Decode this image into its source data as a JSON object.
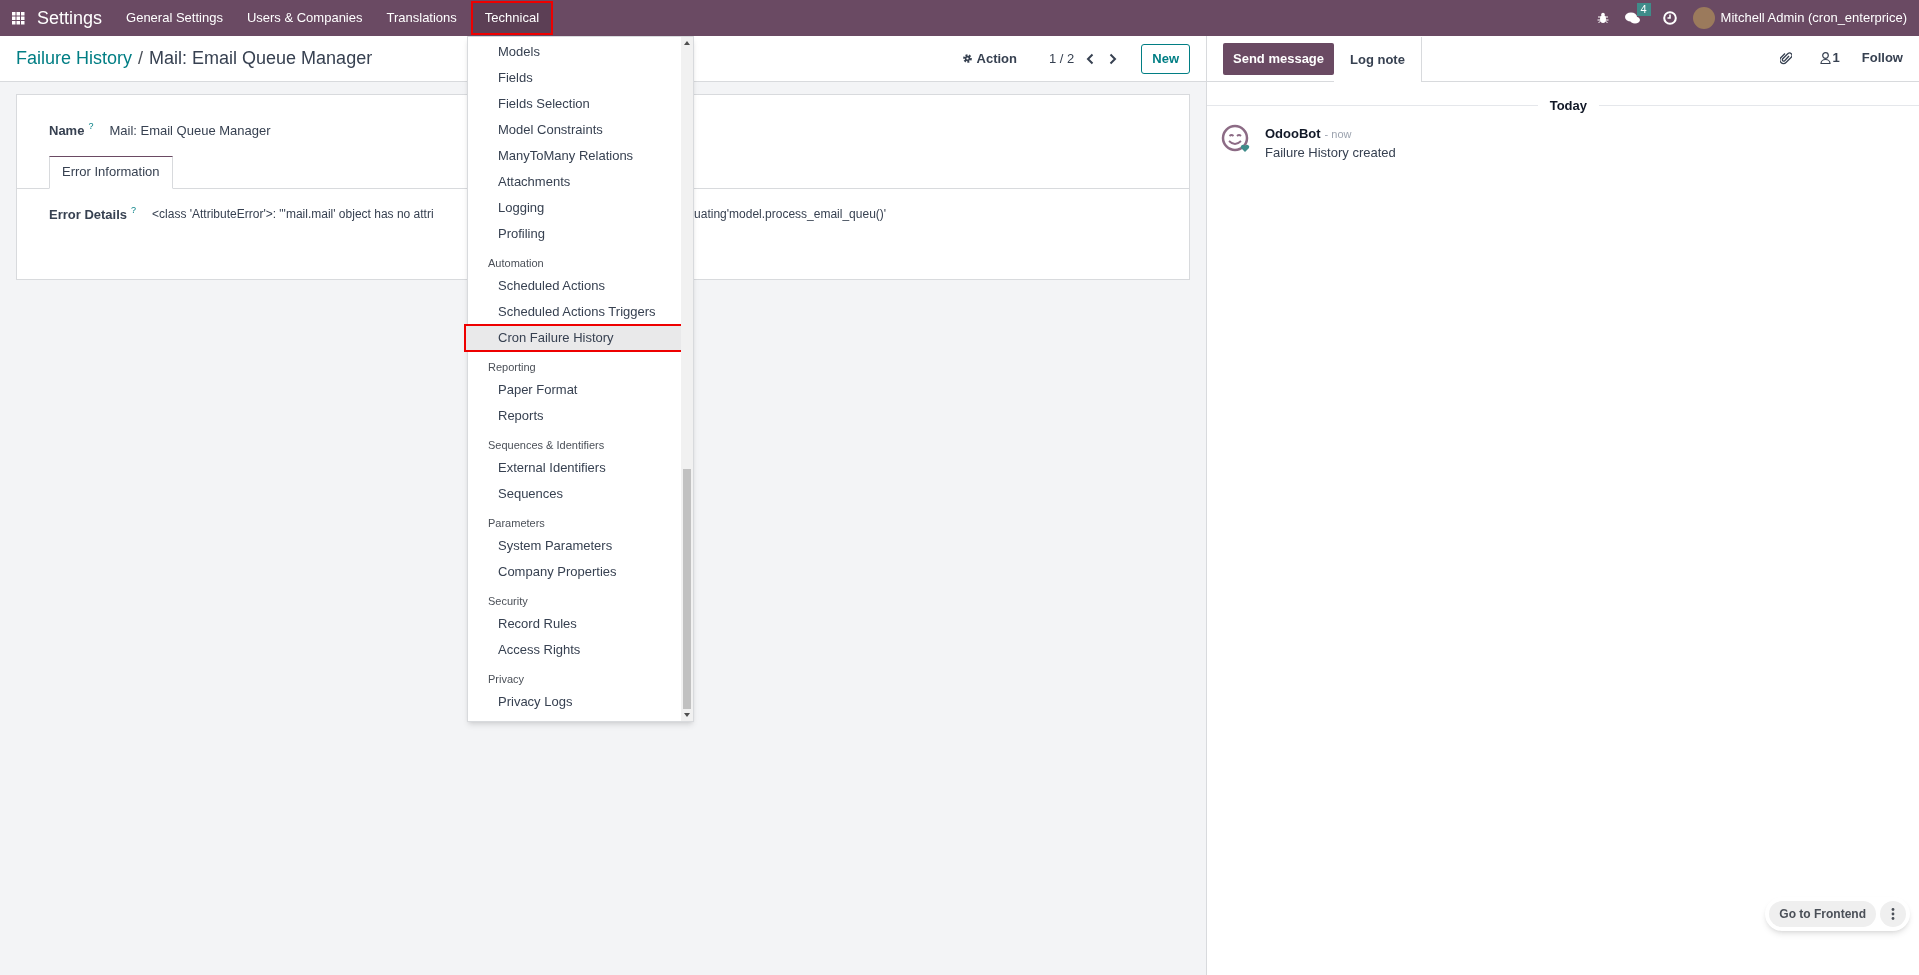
{
  "navbar": {
    "app_name": "Settings",
    "menus": [
      {
        "label": "General Settings",
        "selected": false
      },
      {
        "label": "Users & Companies",
        "selected": false
      },
      {
        "label": "Translations",
        "selected": false
      },
      {
        "label": "Technical",
        "selected": true
      }
    ],
    "messages_count": "4",
    "user_name": "Mitchell Admin (cron_enterprice)"
  },
  "breadcrumb": {
    "parent": "Failure History",
    "separator": "/",
    "current": "Mail: Email Queue Manager"
  },
  "control_panel": {
    "action": "Action",
    "pager": "1 / 2",
    "new_button": "New"
  },
  "form": {
    "name_label": "Name",
    "name_help": "?",
    "name_value": "Mail: Email Queue Manager",
    "tabs": [
      {
        "label": "Error Information",
        "selected": true
      }
    ],
    "error_label": "Error Details",
    "error_help": "?",
    "error_text_start": "<class 'AttributeError'>: \"'mail.mail' object has no attri",
    "error_text_end": "uating'model.process_email_queu()'"
  },
  "dropdown": {
    "sections": [
      {
        "items": [
          {
            "label": "Models",
            "selected": false
          },
          {
            "label": "Fields",
            "selected": false
          },
          {
            "label": "Fields Selection",
            "selected": false
          },
          {
            "label": "Model Constraints",
            "selected": false
          },
          {
            "label": "ManyToMany Relations",
            "selected": false
          },
          {
            "label": "Attachments",
            "selected": false
          },
          {
            "label": "Logging",
            "selected": false
          },
          {
            "label": "Profiling",
            "selected": false
          }
        ]
      },
      {
        "heading": "Automation",
        "items": [
          {
            "label": "Scheduled Actions",
            "selected": false
          },
          {
            "label": "Scheduled Actions Triggers",
            "selected": false
          },
          {
            "label": "Cron Failure History",
            "selected": true
          }
        ]
      },
      {
        "heading": "Reporting",
        "items": [
          {
            "label": "Paper Format",
            "selected": false
          },
          {
            "label": "Reports",
            "selected": false
          }
        ]
      },
      {
        "heading": "Sequences & Identifiers",
        "items": [
          {
            "label": "External Identifiers",
            "selected": false
          },
          {
            "label": "Sequences",
            "selected": false
          }
        ]
      },
      {
        "heading": "Parameters",
        "items": [
          {
            "label": "System Parameters",
            "selected": false
          },
          {
            "label": "Company Properties",
            "selected": false
          }
        ]
      },
      {
        "heading": "Security",
        "items": [
          {
            "label": "Record Rules",
            "selected": false
          },
          {
            "label": "Access Rights",
            "selected": false
          }
        ]
      },
      {
        "heading": "Privacy",
        "items": [
          {
            "label": "Privacy Logs",
            "selected": false
          }
        ]
      }
    ]
  },
  "chatter": {
    "send_message": "Send message",
    "log_note": "Log note",
    "followers_count": "1",
    "follow": "Follow",
    "date_divider": "Today",
    "messages": [
      {
        "author": "OdooBot",
        "time": "- now",
        "body": "Failure History created"
      }
    ]
  },
  "frontend_button": "Go to Frontend"
}
